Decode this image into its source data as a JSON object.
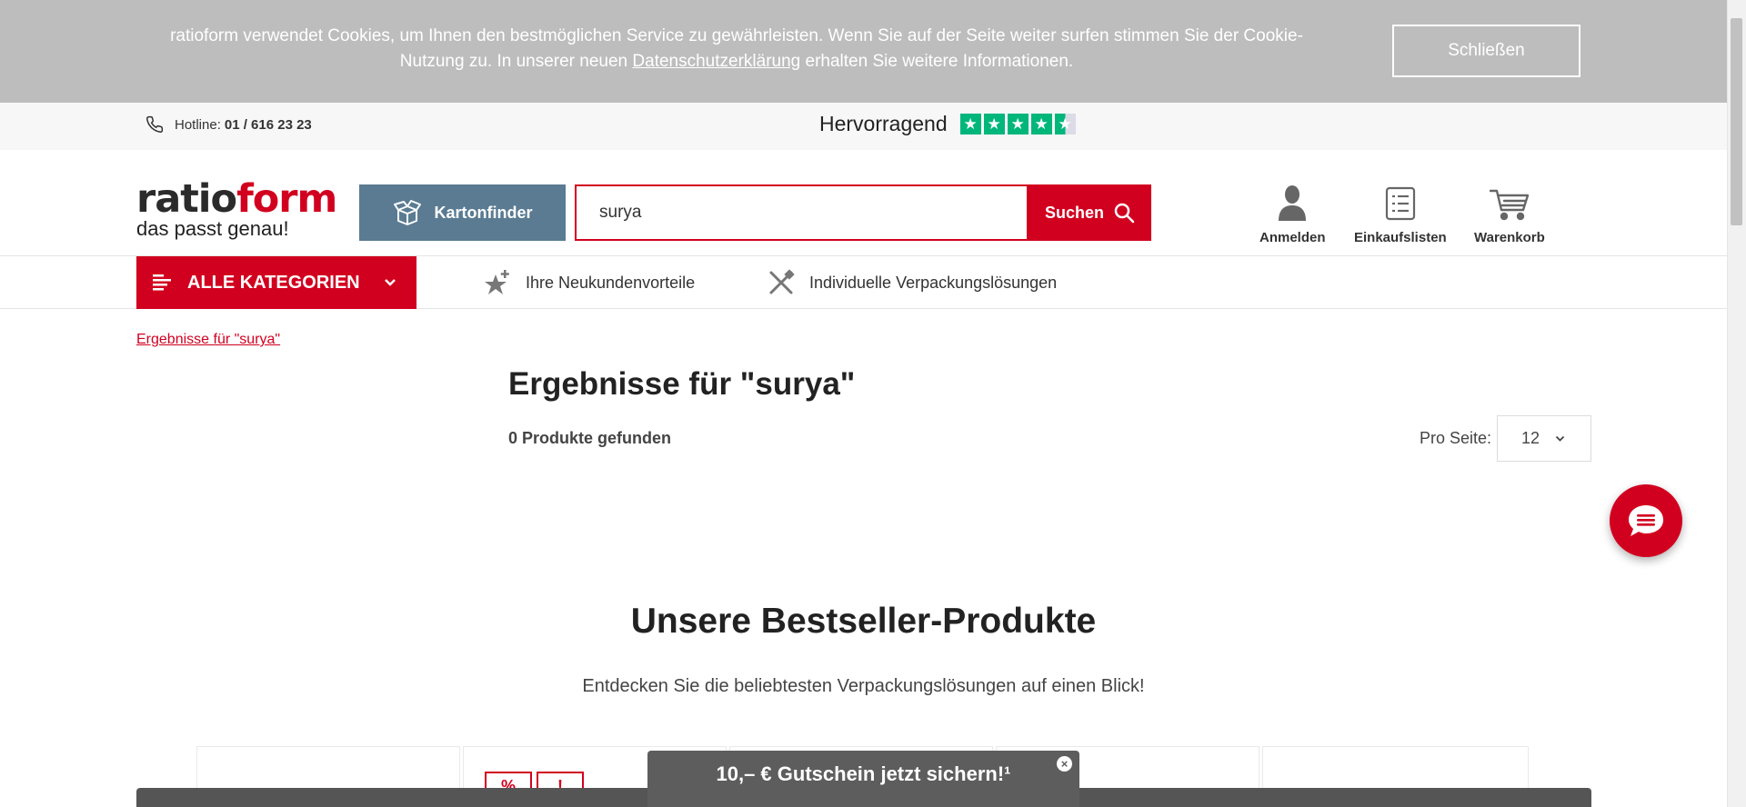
{
  "cookie": {
    "text_before": "ratioform verwendet Cookies, um Ihnen den bestmöglichen Service zu gewährleisten. Wenn Sie auf der Seite weiter surfen stimmen Sie der Cookie-Nutzung zu. In unserer neuen ",
    "link": "Datenschutzerklärung",
    "text_after": " erhalten Sie weitere Informationen.",
    "close_label": "Schließen"
  },
  "topbar": {
    "hotline_label": "Hotline:",
    "hotline_number": "01 / 616 23 23",
    "rating_label": "Hervorragend",
    "rating_stars": 4.5
  },
  "header": {
    "logo_ratio": "ratio",
    "logo_form": "form",
    "logo_tagline": "das passt genau!",
    "kartonfinder_label": "Kartonfinder",
    "search_value": "surya",
    "search_button": "Suchen",
    "actions": [
      {
        "label": "Anmelden",
        "icon": "user-icon"
      },
      {
        "label": "Einkaufslisten",
        "icon": "list-icon"
      },
      {
        "label": "Warenkorb",
        "icon": "cart-icon"
      }
    ]
  },
  "nav": {
    "all_categories": "ALLE KATEGORIEN",
    "links": [
      {
        "label": "Ihre Neukundenvorteile",
        "icon": "star-plus-icon"
      },
      {
        "label": "Individuelle Verpackungslösungen",
        "icon": "tools-icon"
      }
    ]
  },
  "results": {
    "breadcrumb": "Ergebnisse für \"surya\"",
    "title": "Ergebnisse für \"surya\"",
    "count": "0 Produkte gefunden",
    "per_page_label": "Pro Seite:",
    "per_page_value": "12"
  },
  "bestseller": {
    "title": "Unsere Bestseller-Produkte",
    "subtitle": "Entdecken Sie die beliebtesten Verpackungslösungen auf einen Blick!"
  },
  "voucher": {
    "text": "10,– € Gutschein jetzt sichern!¹"
  },
  "colors": {
    "brand_red": "#d2001f",
    "kartonfinder_blue": "#5a7b92",
    "cookie_grey": "#bdbdbd",
    "trustpilot_green": "#00b67a"
  }
}
